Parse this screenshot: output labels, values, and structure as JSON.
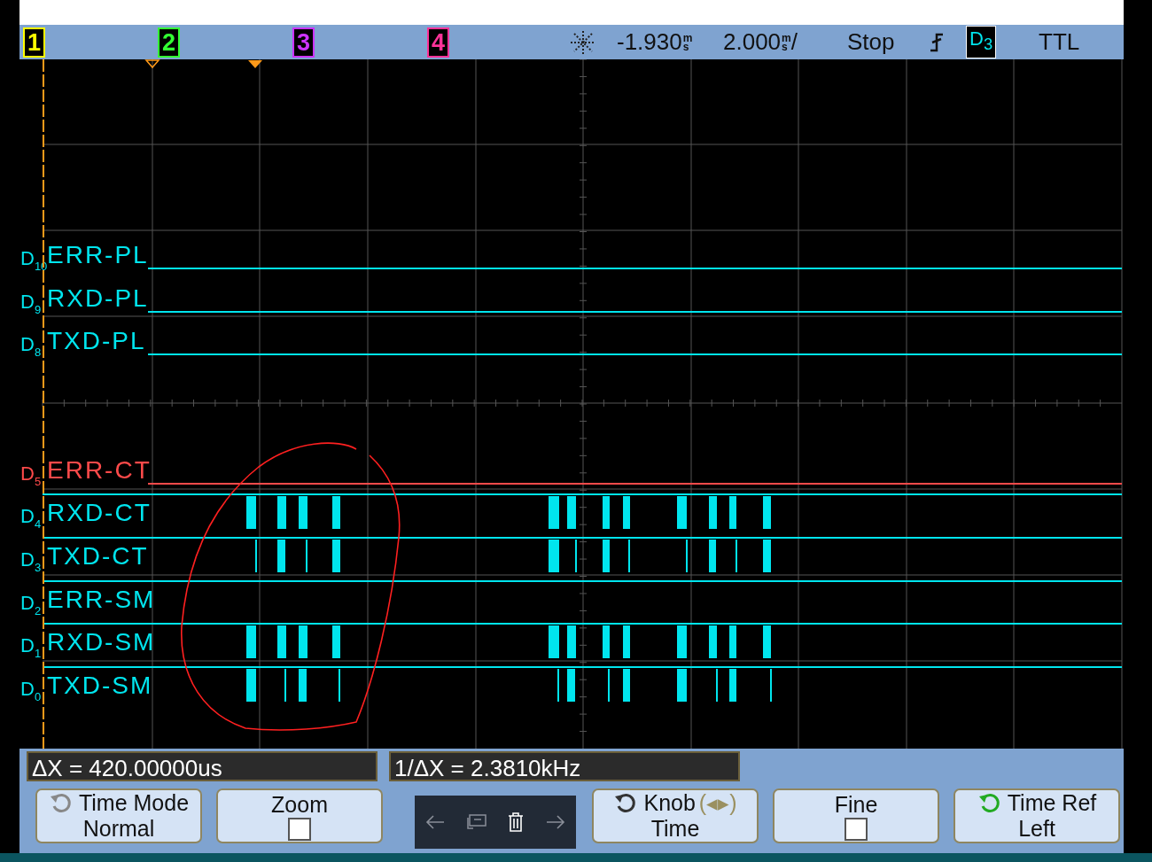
{
  "top_bar": {
    "channels": [
      {
        "label": "1",
        "color": "#ffff00"
      },
      {
        "label": "2",
        "color": "#33ff33"
      },
      {
        "label": "3",
        "color": "#cc33ff"
      },
      {
        "label": "4",
        "color": "#ff3399"
      }
    ],
    "delay": {
      "value": "-1.930",
      "unit_top": "m",
      "unit_bottom": "s"
    },
    "timebase": {
      "value": "2.000",
      "unit_top": "m",
      "unit_bottom": "s",
      "suffix": "/"
    },
    "status": "Stop",
    "trigger_source": "D$_{3}$",
    "threshold": "TTL"
  },
  "channels": [
    {
      "label": "D",
      "index": "10",
      "name": "ERR-PL",
      "color": "#00e5ee"
    },
    {
      "label": "D",
      "index": "9",
      "name": "RXD-PL",
      "color": "#00e5ee"
    },
    {
      "label": "D",
      "index": "8",
      "name": "TXD-PL",
      "color": "#00e5ee"
    },
    {
      "label": "D",
      "index": "5",
      "name": "ERR-CT",
      "color": "#ff4a4a"
    },
    {
      "label": "D",
      "index": "4",
      "name": "RXD-CT",
      "color": "#00e5ee"
    },
    {
      "label": "D",
      "index": "3",
      "name": "TXD-CT",
      "color": "#00e5ee"
    },
    {
      "label": "D",
      "index": "2",
      "name": "ERR-SM",
      "color": "#00e5ee"
    },
    {
      "label": "D",
      "index": "1",
      "name": "RXD-SM",
      "color": "#00e5ee"
    },
    {
      "label": "D",
      "index": "0",
      "name": "TXD-SM",
      "color": "#00e5ee"
    }
  ],
  "measurements": [
    "ΔX = 420.00000us",
    "1/ΔX = 2.3810kHz"
  ],
  "softkeys_left": [
    {
      "kind": "cycle",
      "line1": "Time Mode",
      "line2": "Normal"
    },
    {
      "kind": "checkbox",
      "line1": "Zoom",
      "checked": false
    }
  ],
  "softkeys_right": [
    {
      "kind": "knob",
      "line1": "Knob",
      "hint": "(◂▸)",
      "line2": "Time"
    },
    {
      "kind": "checkbox",
      "line1": "Fine",
      "checked": false
    },
    {
      "kind": "cycle",
      "line1": "Time Ref",
      "line2": "Left",
      "active": true
    }
  ]
}
